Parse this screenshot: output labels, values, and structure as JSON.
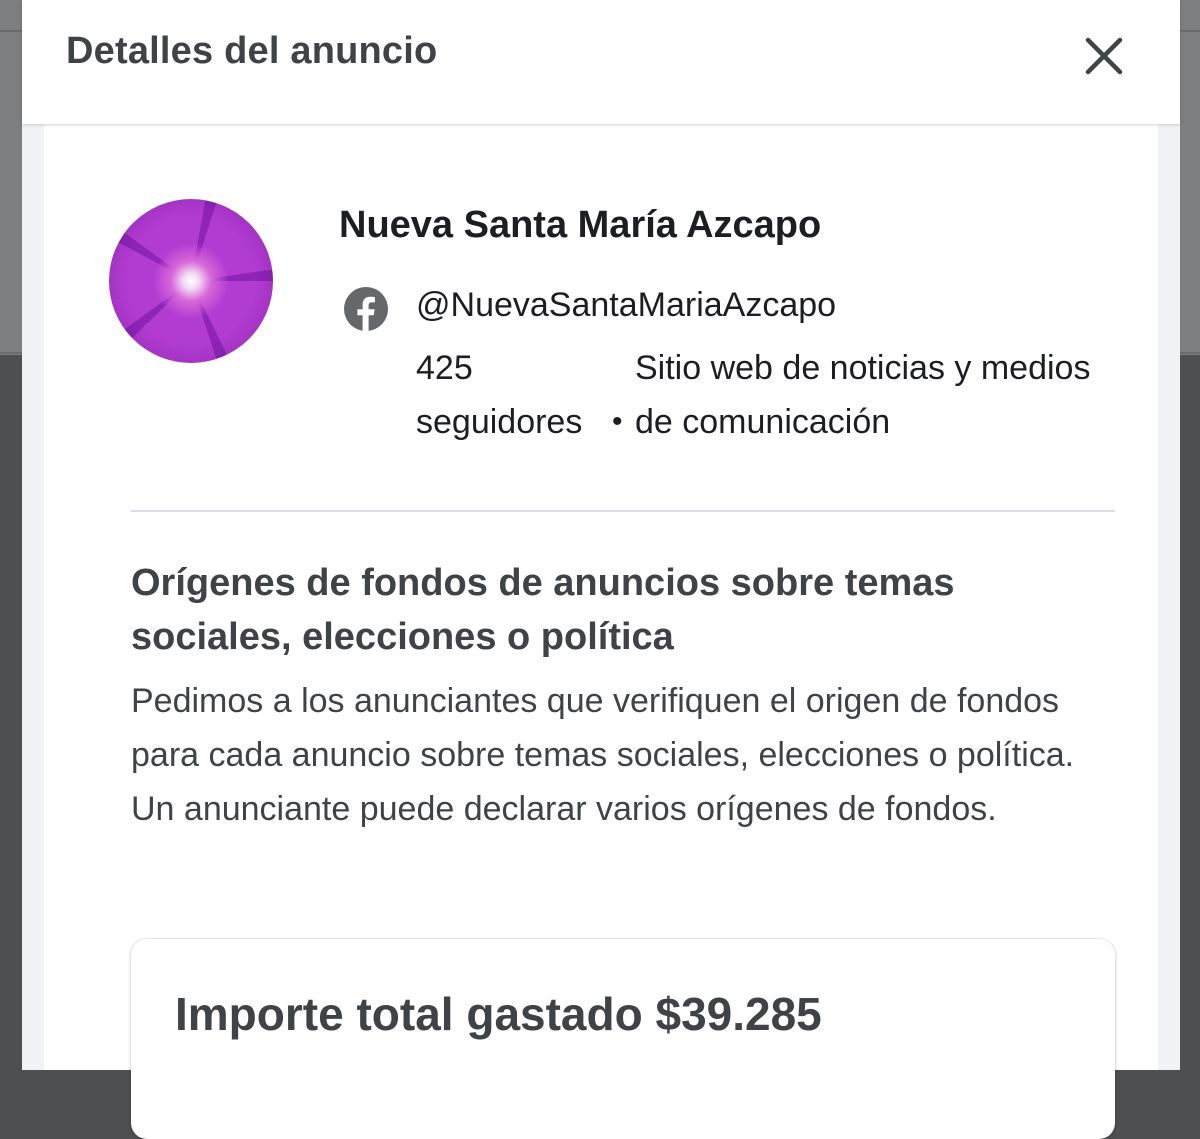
{
  "modal": {
    "title": "Detalles del anuncio",
    "close_icon": "close-icon"
  },
  "advertiser": {
    "name": "Nueva Santa María Azcapo",
    "platform_icon": "facebook-icon",
    "handle": "@NuevaSantaMariaAzcapo",
    "followers": "425 seguidores",
    "separator": "•",
    "category": "Sitio web de noticias y medios de comunicación"
  },
  "funding": {
    "heading": "Orígenes de fondos de anuncios sobre temas sociales, elecciones o política",
    "description": "Pedimos a los anunciantes que verifiquen el origen de fondos para cada anuncio sobre temas sociales, elecciones o política. Un anunciante puede declarar varios orígenes de fondos."
  },
  "spend": {
    "total_label": "Importe total gastado $39.285"
  },
  "colors": {
    "heading_text": "#404346",
    "body_text": "#1c1e21",
    "panel_bg": "#ffffff",
    "backdrop": "#4e4f51",
    "facebook_icon": "#65676b"
  }
}
